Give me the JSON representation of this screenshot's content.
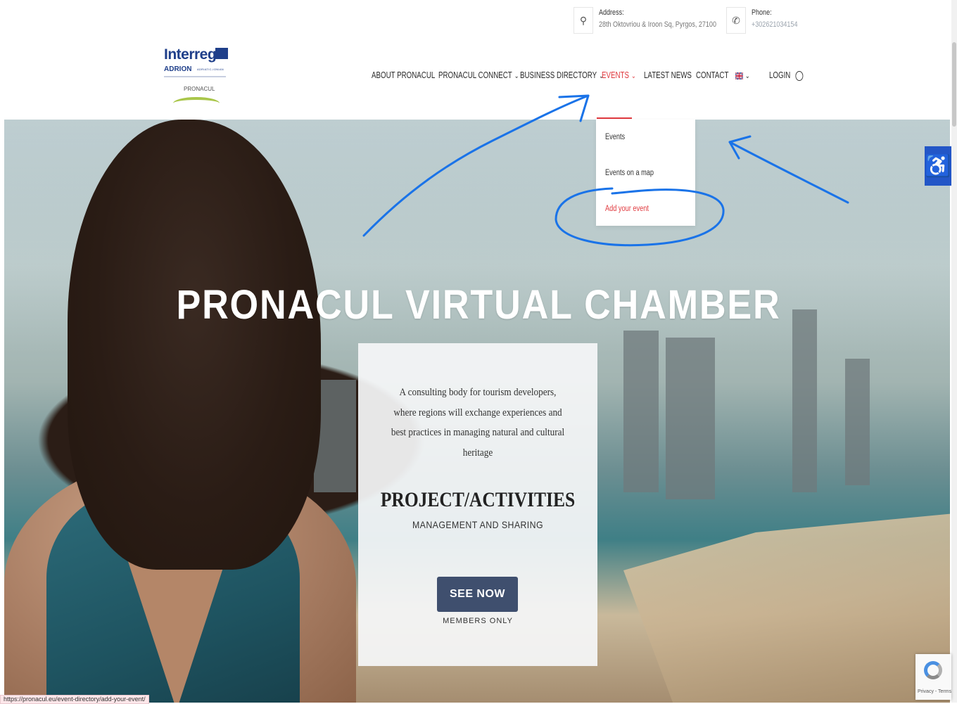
{
  "header": {
    "address_label": "Address:",
    "address_value": "28th Oktovriou & Iroon Sq, Pyrgos, 27100",
    "phone_label": "Phone:",
    "phone_value": "+302621034154"
  },
  "logo": {
    "brand": "Interreg",
    "program": "ADRION",
    "program_sub": "ADRIATIC-IONIAN",
    "project": "PRONACUL"
  },
  "nav": {
    "items": [
      {
        "label": "ABOUT PRONACUL",
        "has_dropdown": false
      },
      {
        "label": "PRONACUL CONNECT",
        "has_dropdown": true
      },
      {
        "label": "BUSINESS DIRECTORY",
        "has_dropdown": true
      },
      {
        "label": "EVENTS",
        "has_dropdown": true,
        "active": true
      },
      {
        "label": "LATEST NEWS",
        "has_dropdown": false
      },
      {
        "label": "CONTACT",
        "has_dropdown": false
      }
    ],
    "language_icon": "uk-flag-icon",
    "login_label": "LOGIN"
  },
  "events_dropdown": {
    "items": [
      "Events",
      "Events on a map",
      "Add your event"
    ],
    "highlighted": "Add your event"
  },
  "hero": {
    "title": "PRONACUL VIRTUAL CHAMBER",
    "card": {
      "description": "A consulting body for tourism developers, where regions will exchange experiences and best practices in managing natural and cultural heritage",
      "heading": "PROJECT/ACTIVITIES",
      "subheading": "MANAGEMENT AND SHARING",
      "button_label": "SEE NOW",
      "button_note": "MEMBERS ONLY"
    }
  },
  "status_bar_url": "https://pronacul.eu/event-directory/add-your-event/",
  "recaptcha_text": "Privacy - Terms",
  "colors": {
    "accent_red": "#e0393e",
    "button_navy": "#3f4f6e",
    "accessibility_blue": "#2356c7",
    "annotation_blue": "#1a73e8"
  }
}
